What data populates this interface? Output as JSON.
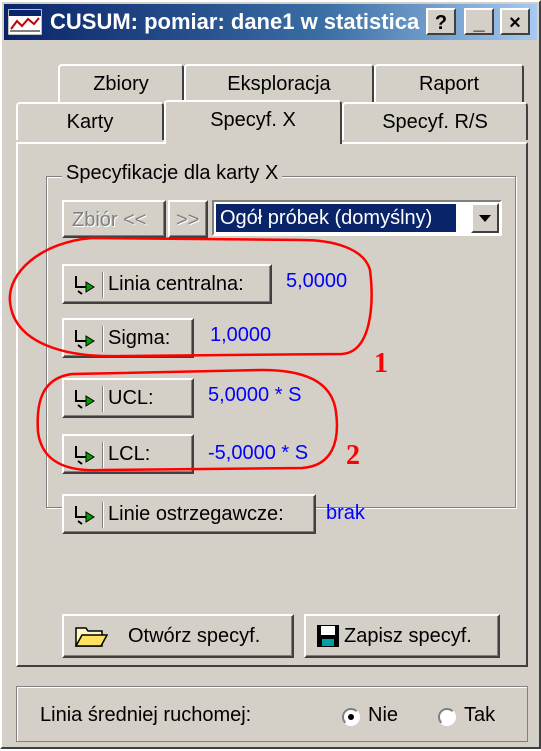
{
  "window": {
    "title": "CUSUM: pomiar: dane1 w statistica",
    "buttons": [
      "?",
      "_",
      "×"
    ]
  },
  "tabs": {
    "row1": [
      "Zbiory",
      "Eksploracja",
      "Raport"
    ],
    "row2": [
      "Karty",
      "Specyf. X",
      "Specyf. R/S"
    ],
    "active": "Specyf. X"
  },
  "group": {
    "title": "Specyfikacje dla karty X",
    "nav_prev": "Zbiór <<",
    "nav_next": ">>",
    "combo_value": "Ogół próbek (domyślny)"
  },
  "rows": {
    "central": {
      "label": "Linia centralna:",
      "value": "5,0000"
    },
    "sigma": {
      "label": "Sigma:",
      "value": "1,0000"
    },
    "ucl": {
      "label": "UCL:",
      "value": "5,0000 * S"
    },
    "lcl": {
      "label": "LCL:",
      "value": "-5,0000 * S"
    },
    "warning": {
      "label": "Linie ostrzegawcze:",
      "value": "brak"
    }
  },
  "file_buttons": {
    "open": "Otwórz specyf.",
    "save": "Zapisz specyf."
  },
  "moving_avg": {
    "label": "Linia średniej ruchomej:",
    "options": [
      "Nie",
      "Tak"
    ],
    "selected": "Nie"
  },
  "annotations": {
    "one": "1",
    "two": "2",
    "color": "#ff0000"
  },
  "colors": {
    "value_text": "#0000ff",
    "title_bar": "#0a246a",
    "face": "#d4d0c8"
  }
}
